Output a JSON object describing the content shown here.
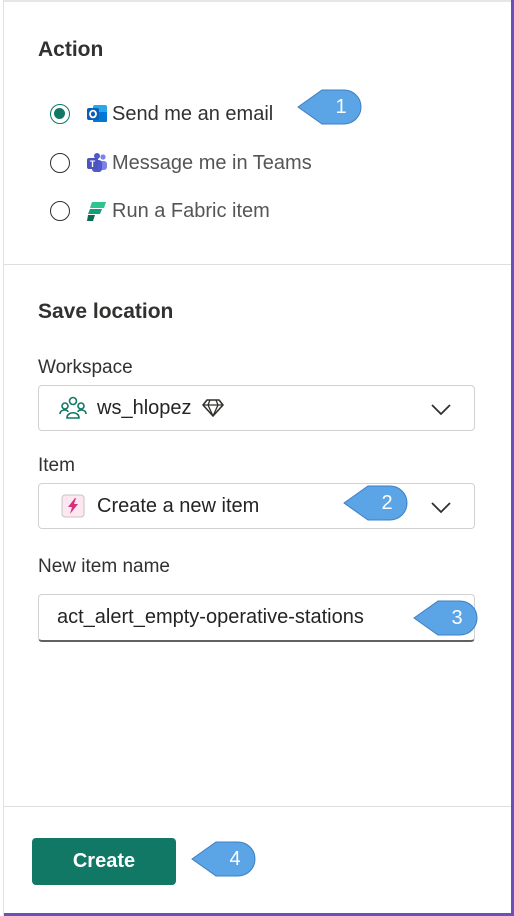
{
  "action": {
    "title": "Action",
    "options": [
      {
        "label": "Send me an email",
        "checked": true,
        "icon": "outlook-icon"
      },
      {
        "label": "Message me in Teams",
        "checked": false,
        "icon": "teams-icon"
      },
      {
        "label": "Run a Fabric item",
        "checked": false,
        "icon": "fabric-icon"
      }
    ]
  },
  "save_location": {
    "title": "Save location",
    "workspace": {
      "label": "Workspace",
      "value": "ws_hlopez",
      "icon": "workspace-people-icon",
      "badge_icon": "diamond-icon"
    },
    "item": {
      "label": "Item",
      "value": "Create a new item",
      "icon": "activator-icon"
    },
    "new_item_name": {
      "label": "New item name",
      "value": "act_alert_empty-operative-stations"
    }
  },
  "footer": {
    "create_label": "Create"
  },
  "callouts": [
    "1",
    "2",
    "3",
    "4"
  ],
  "colors": {
    "accent": "#117865",
    "callout": "#5ba4e6",
    "frame": "#6b4fbb"
  }
}
